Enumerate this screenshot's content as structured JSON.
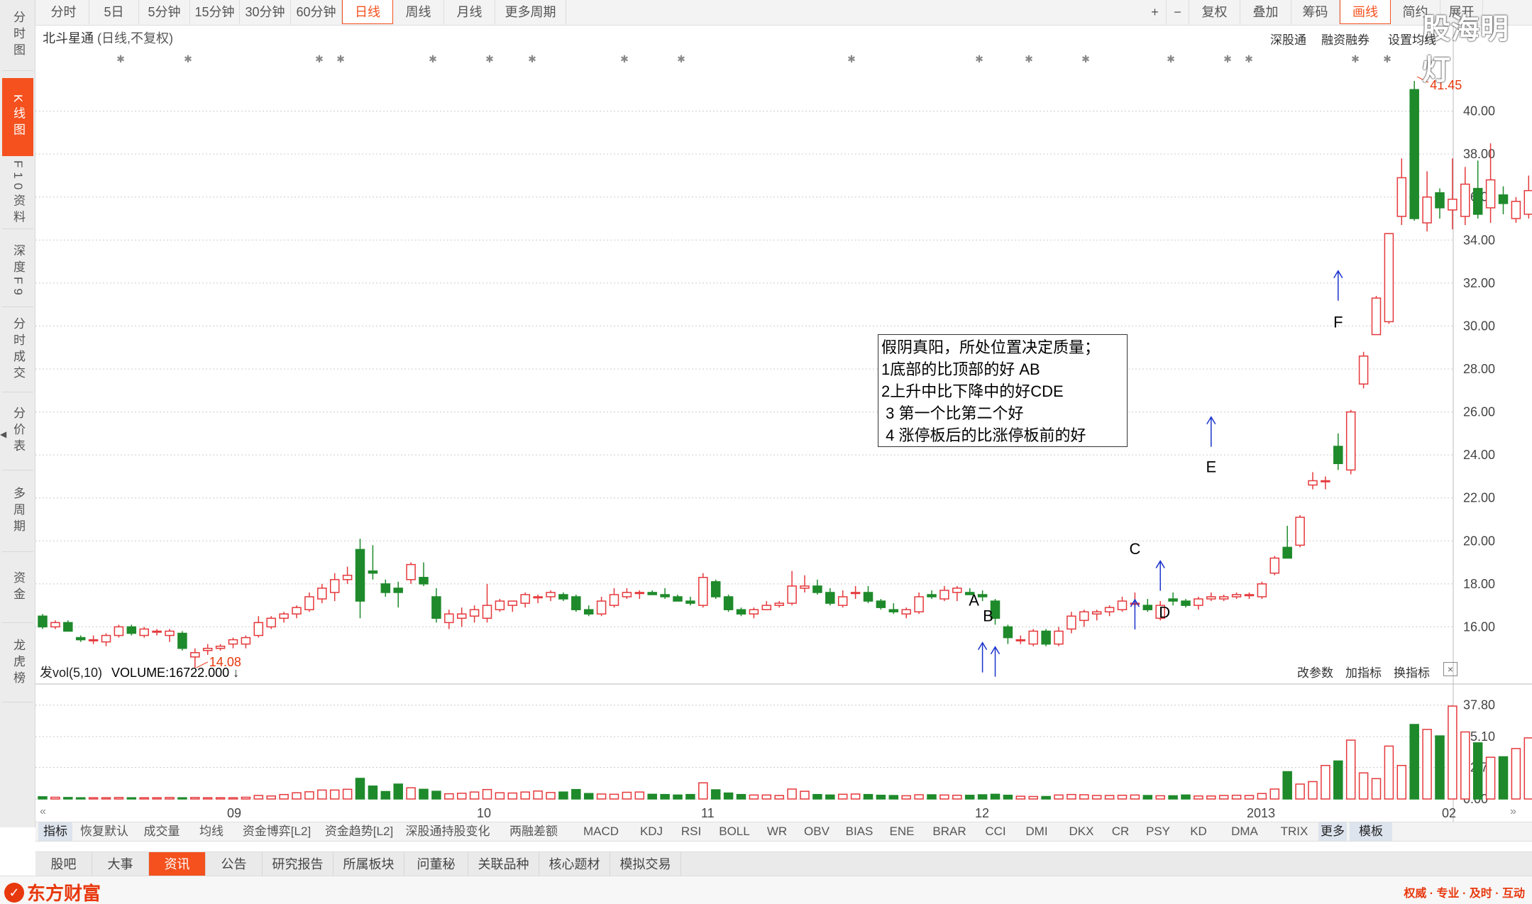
{
  "left_nav": [
    {
      "label": "分时图",
      "active": false
    },
    {
      "label": "K线图",
      "active": true
    },
    {
      "label": "F10资料",
      "active": false
    },
    {
      "label": "深度F9",
      "active": false
    },
    {
      "label": "分时成交",
      "active": false
    },
    {
      "label": "分价表",
      "active": false
    },
    {
      "label": "多周期",
      "active": false
    },
    {
      "label": "资金",
      "active": false
    },
    {
      "label": "龙虎榜",
      "active": false
    }
  ],
  "top_periods": [
    "分时",
    "5日",
    "5分钟",
    "15分钟",
    "30分钟",
    "60分钟",
    "日线",
    "周线",
    "月线",
    "更多周期"
  ],
  "active_period": "日线",
  "right_tools": [
    "+",
    "−",
    "复权",
    "叠加",
    "筹码",
    "画线",
    "简约",
    "展开"
  ],
  "stock": {
    "name": "北斗星通",
    "mode": "(日线,不复权)"
  },
  "right_links": [
    "深股通",
    "融资融券",
    "设置均线"
  ],
  "price_axis": [
    "40.00",
    "38.00",
    "36.00",
    "34.00",
    "32.00",
    "30.00",
    "28.00",
    "26.00",
    "24.00",
    "22.00",
    "20.00",
    "18.00",
    "16.00"
  ],
  "max_label": "41.45",
  "min_label": "14.08",
  "annotation_lines": [
    "假阴真阳，所处位置决定质量；",
    "1底部的比顶部的好 AB",
    "2上升中比下降中的好CDE",
    " 3 第一个比第二个好",
    " 4 涨停板后的比涨停板前的好"
  ],
  "point_labels": [
    "A",
    "B",
    "C",
    "D",
    "E",
    "F"
  ],
  "volume": {
    "header": "发vol(5,10)",
    "value": "VOLUME:16722.000",
    "arrow": "↓",
    "links": [
      "改参数",
      "加指标",
      "换指标"
    ],
    "close": "×",
    "axis": [
      "37.80",
      "25.10",
      "12.70",
      "0.00"
    ]
  },
  "date_axis": [
    "09",
    "10",
    "11",
    "12",
    "2013",
    "02"
  ],
  "indicators": [
    "指标",
    "恢复默认",
    "成交量",
    "均线",
    "资金博弈[L2]",
    "资金趋势[L2]",
    "深股通持股变化",
    "两融差额",
    "MACD",
    "KDJ",
    "RSI",
    "BOLL",
    "WR",
    "OBV",
    "BIAS",
    "ENE",
    "BRAR",
    "CCI",
    "DMI",
    "DKX",
    "CR",
    "PSY",
    "KD",
    "DMA",
    "TRIX",
    "更多",
    "模板"
  ],
  "info_tabs": [
    "股吧",
    "大事",
    "资讯",
    "公告",
    "研究报告",
    "所属板块",
    "问董秘",
    "关联品种",
    "核心题材",
    "模拟交易"
  ],
  "active_info": "资讯",
  "brand": "东方财富",
  "slogan": "权威 · 专业 · 及时 · 互动",
  "watermark": "股海明灯",
  "colors": {
    "up": "#e5383b",
    "down": "#1e8a2b",
    "accent": "#f4511e",
    "arrow": "#1a33cc"
  },
  "chart_data": {
    "type": "candlestick",
    "ohlc": [
      [
        16.5,
        16.6,
        15.9,
        16.0
      ],
      [
        16.0,
        16.3,
        15.9,
        16.2
      ],
      [
        16.2,
        16.3,
        15.8,
        15.8
      ],
      [
        15.5,
        15.6,
        15.3,
        15.4
      ],
      [
        15.4,
        15.6,
        15.2,
        15.4
      ],
      [
        15.3,
        15.7,
        15.1,
        15.6
      ],
      [
        15.6,
        16.1,
        15.5,
        16.0
      ],
      [
        16.0,
        16.1,
        15.6,
        15.7
      ],
      [
        15.6,
        16.0,
        15.5,
        15.9
      ],
      [
        15.8,
        15.9,
        15.6,
        15.8
      ],
      [
        15.6,
        15.9,
        15.3,
        15.8
      ],
      [
        15.7,
        15.8,
        14.9,
        15.0
      ],
      [
        14.6,
        15.0,
        14.1,
        14.8
      ],
      [
        14.9,
        15.2,
        14.7,
        15.0
      ],
      [
        15.0,
        15.2,
        14.9,
        15.1
      ],
      [
        15.2,
        15.5,
        15.0,
        15.4
      ],
      [
        15.2,
        15.6,
        15.0,
        15.5
      ],
      [
        15.6,
        16.5,
        15.5,
        16.2
      ],
      [
        16.0,
        16.5,
        15.9,
        16.4
      ],
      [
        16.4,
        16.7,
        16.2,
        16.6
      ],
      [
        16.6,
        17.0,
        16.4,
        16.9
      ],
      [
        16.8,
        17.6,
        16.7,
        17.4
      ],
      [
        17.3,
        18.0,
        17.1,
        17.8
      ],
      [
        17.6,
        18.5,
        17.2,
        18.2
      ],
      [
        18.2,
        18.8,
        18.0,
        18.4
      ],
      [
        19.6,
        20.1,
        16.4,
        17.2
      ],
      [
        18.6,
        19.8,
        18.2,
        18.5
      ],
      [
        18.0,
        18.2,
        17.4,
        17.6
      ],
      [
        17.8,
        18.1,
        16.9,
        17.6
      ],
      [
        18.2,
        19.0,
        18.0,
        18.9
      ],
      [
        18.3,
        19.0,
        17.9,
        18.0
      ],
      [
        17.4,
        17.8,
        16.2,
        16.4
      ],
      [
        16.2,
        16.8,
        15.9,
        16.6
      ],
      [
        16.4,
        16.9,
        16.0,
        16.6
      ],
      [
        16.5,
        17.0,
        16.2,
        16.8
      ],
      [
        16.4,
        18.0,
        16.2,
        17.0
      ],
      [
        16.8,
        17.3,
        16.7,
        17.2
      ],
      [
        17.0,
        17.2,
        16.7,
        17.2
      ],
      [
        17.1,
        17.6,
        16.9,
        17.5
      ],
      [
        17.4,
        17.5,
        17.1,
        17.4
      ],
      [
        17.4,
        17.7,
        17.2,
        17.6
      ],
      [
        17.5,
        17.6,
        17.2,
        17.3
      ],
      [
        17.4,
        17.5,
        16.7,
        16.8
      ],
      [
        16.8,
        17.0,
        16.5,
        16.6
      ],
      [
        16.6,
        17.4,
        16.5,
        17.2
      ],
      [
        17.0,
        17.8,
        16.9,
        17.5
      ],
      [
        17.4,
        17.8,
        17.3,
        17.6
      ],
      [
        17.6,
        17.7,
        17.3,
        17.6
      ],
      [
        17.6,
        17.7,
        17.5,
        17.5
      ],
      [
        17.5,
        17.8,
        17.3,
        17.4
      ],
      [
        17.4,
        17.5,
        17.2,
        17.2
      ],
      [
        17.2,
        17.4,
        17.0,
        17.1
      ],
      [
        17.0,
        18.5,
        16.9,
        18.3
      ],
      [
        18.1,
        18.2,
        17.3,
        17.4
      ],
      [
        17.4,
        17.5,
        16.7,
        16.8
      ],
      [
        16.8,
        16.9,
        16.5,
        16.6
      ],
      [
        16.6,
        16.9,
        16.4,
        16.8
      ],
      [
        16.8,
        17.2,
        16.8,
        17.0
      ],
      [
        17.0,
        17.2,
        16.9,
        17.1
      ],
      [
        17.1,
        18.6,
        17.0,
        17.9
      ],
      [
        17.8,
        18.4,
        17.6,
        17.9
      ],
      [
        17.9,
        18.2,
        17.5,
        17.6
      ],
      [
        17.6,
        17.8,
        17.0,
        17.1
      ],
      [
        17.0,
        17.7,
        16.9,
        17.4
      ],
      [
        17.6,
        17.9,
        17.3,
        17.6
      ],
      [
        17.6,
        17.9,
        17.1,
        17.2
      ],
      [
        17.2,
        17.3,
        16.8,
        16.9
      ],
      [
        16.8,
        17.1,
        16.6,
        16.7
      ],
      [
        16.6,
        16.9,
        16.4,
        16.8
      ],
      [
        16.7,
        17.6,
        16.6,
        17.4
      ],
      [
        17.5,
        17.7,
        17.3,
        17.4
      ],
      [
        17.3,
        17.9,
        17.2,
        17.7
      ],
      [
        17.6,
        17.9,
        17.2,
        17.8
      ],
      [
        17.6,
        17.8,
        17.5,
        17.5
      ],
      [
        17.5,
        17.7,
        17.2,
        17.4
      ],
      [
        17.2,
        17.3,
        16.1,
        16.4
      ],
      [
        16.0,
        16.1,
        15.2,
        15.5
      ],
      [
        15.4,
        15.6,
        15.2,
        15.4
      ],
      [
        15.2,
        15.9,
        15.1,
        15.8
      ],
      [
        15.8,
        15.9,
        15.1,
        15.2
      ],
      [
        15.2,
        16.0,
        15.1,
        15.8
      ],
      [
        15.9,
        16.7,
        15.7,
        16.5
      ],
      [
        16.3,
        16.8,
        16.0,
        16.7
      ],
      [
        16.6,
        16.8,
        16.3,
        16.7
      ],
      [
        16.7,
        17.0,
        16.5,
        16.9
      ],
      [
        16.8,
        17.4,
        16.7,
        17.2
      ],
      [
        17.1,
        17.6,
        16.9,
        17.1
      ],
      [
        17.0,
        17.3,
        16.7,
        16.8
      ],
      [
        16.4,
        17.2,
        16.3,
        17.0
      ],
      [
        17.3,
        17.6,
        17.0,
        17.2
      ],
      [
        17.2,
        17.3,
        16.9,
        17.0
      ],
      [
        17.0,
        17.4,
        16.8,
        17.3
      ],
      [
        17.3,
        17.6,
        17.2,
        17.4
      ],
      [
        17.3,
        17.5,
        17.2,
        17.4
      ],
      [
        17.4,
        17.6,
        17.3,
        17.5
      ],
      [
        17.5,
        17.6,
        17.3,
        17.5
      ],
      [
        17.4,
        18.1,
        17.3,
        18.0
      ],
      [
        18.5,
        19.3,
        18.4,
        19.2
      ],
      [
        19.7,
        20.7,
        19.2,
        19.2
      ],
      [
        19.8,
        21.2,
        19.7,
        21.1
      ],
      [
        22.6,
        23.2,
        22.4,
        22.8
      ],
      [
        22.8,
        23.0,
        22.4,
        22.8
      ],
      [
        24.4,
        25.0,
        23.3,
        23.6
      ],
      [
        23.3,
        26.1,
        23.1,
        26.0
      ],
      [
        27.3,
        28.8,
        27.1,
        28.6
      ],
      [
        29.6,
        31.4,
        29.6,
        31.3
      ],
      [
        30.2,
        34.3,
        30.1,
        34.3
      ],
      [
        35.1,
        37.8,
        34.7,
        36.9
      ],
      [
        41.0,
        41.4,
        34.9,
        35.0
      ],
      [
        34.8,
        37.2,
        34.4,
        36.0
      ],
      [
        36.2,
        36.4,
        35.0,
        35.5
      ],
      [
        35.4,
        37.8,
        34.5,
        35.9
      ],
      [
        35.1,
        37.4,
        34.7,
        36.6
      ],
      [
        36.4,
        37.7,
        35.0,
        35.2
      ],
      [
        35.5,
        38.5,
        34.8,
        36.8
      ],
      [
        36.1,
        36.5,
        35.2,
        35.7
      ],
      [
        35.0,
        36.0,
        34.8,
        35.8
      ],
      [
        35.2,
        37.0,
        35.0,
        36.3
      ],
      [
        35.9,
        37.5,
        35.5,
        37.2
      ],
      [
        36.0,
        40.1,
        35.7,
        40.1
      ],
      [
        40.1,
        40.2,
        35.3,
        36.6
      ],
      [
        36.1,
        37.1,
        35.5,
        35.9
      ]
    ],
    "volume": [
      0.9,
      0.7,
      0.6,
      0.5,
      0.5,
      0.5,
      0.6,
      0.5,
      0.5,
      0.5,
      0.6,
      0.5,
      0.6,
      0.5,
      0.5,
      0.5,
      0.7,
      1.4,
      1.2,
      1.8,
      2.5,
      2.9,
      3.6,
      3.6,
      3.9,
      8.3,
      5.2,
      3.0,
      6.0,
      4.5,
      3.9,
      3.1,
      2.1,
      2.3,
      2.8,
      3.8,
      2.5,
      2.4,
      2.8,
      3.2,
      2.6,
      2.8,
      3.8,
      2.2,
      2.0,
      1.9,
      2.7,
      2.8,
      1.9,
      1.8,
      1.6,
      1.8,
      6.5,
      3.7,
      2.4,
      1.8,
      1.6,
      1.6,
      1.4,
      4.0,
      3.1,
      1.8,
      1.6,
      1.9,
      2.0,
      1.8,
      1.5,
      1.4,
      1.3,
      1.7,
      1.7,
      1.6,
      1.5,
      1.5,
      1.7,
      1.9,
      1.5,
      1.1,
      1.0,
      1.0,
      1.6,
      1.8,
      1.7,
      1.4,
      1.4,
      1.5,
      1.6,
      1.4,
      1.3,
      1.3,
      1.6,
      1.2,
      1.2,
      1.4,
      1.5,
      1.4,
      2.2,
      4.0,
      11.0,
      6.0,
      7.0,
      13.5,
      15.3,
      23.7,
      10.5,
      8.2,
      21.3,
      13.5,
      30.0,
      28.0,
      25.4,
      37.4,
      27.0,
      22.6,
      16.8,
      17.0,
      20.3,
      24.6,
      13.7,
      17.5,
      14.6,
      27.5,
      23.1,
      15.7
    ],
    "ylim": [
      14.0,
      42.0
    ],
    "vol_ylim": [
      0,
      40.0
    ],
    "x_ticks": [
      "09",
      "10",
      "11",
      "12",
      "2013",
      "02"
    ],
    "annotations": [
      "A",
      "B",
      "C",
      "D",
      "E",
      "F"
    ]
  }
}
